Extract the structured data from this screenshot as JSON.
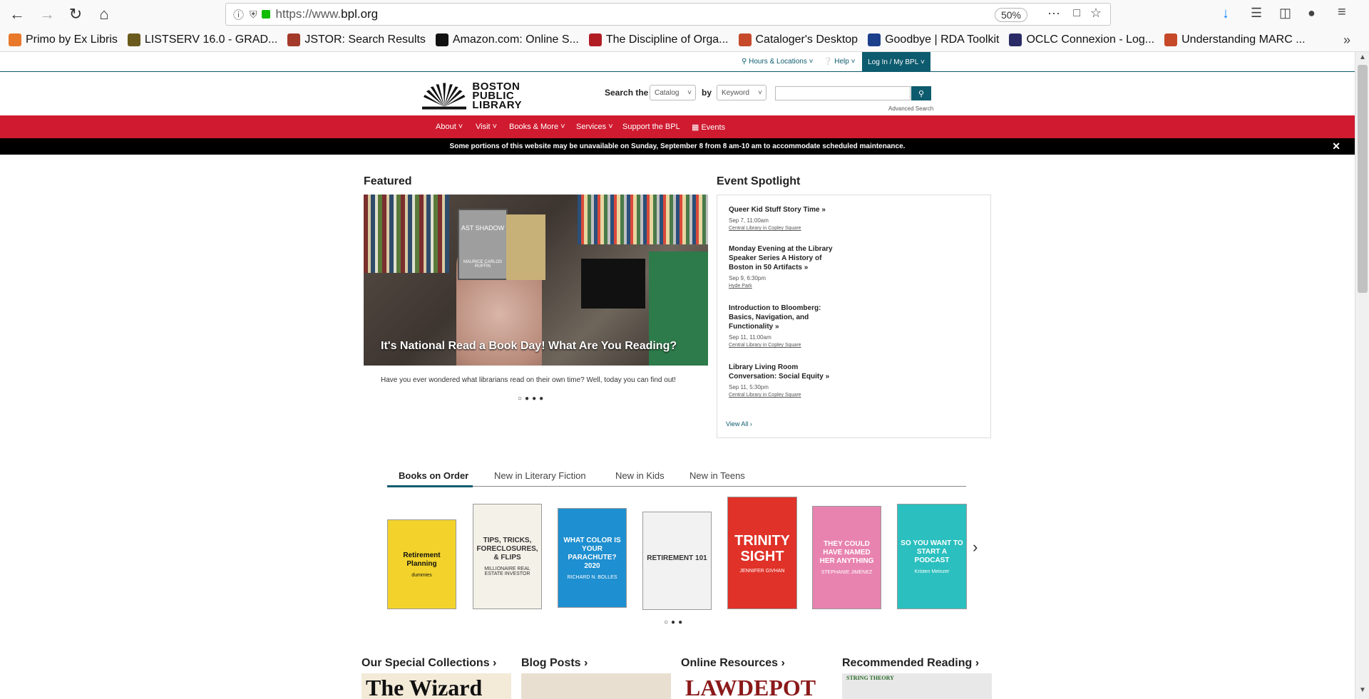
{
  "browser": {
    "url_prefix": "https://www.",
    "url_domain": "bpl.org",
    "zoom": "50%"
  },
  "bookmarks": [
    {
      "label": "Primo by Ex Libris",
      "color": "#e8782a"
    },
    {
      "label": "LISTSERV 16.0 - GRAD...",
      "color": "#6b5a1e"
    },
    {
      "label": "JSTOR: Search Results",
      "color": "#a33a2a"
    },
    {
      "label": "Amazon.com: Online S...",
      "color": "#111111"
    },
    {
      "label": "The Discipline of Orga...",
      "color": "#b01e23"
    },
    {
      "label": "Cataloger's Desktop",
      "color": "#c64a2a"
    },
    {
      "label": "Goodbye | RDA Toolkit",
      "color": "#1b3f8b"
    },
    {
      "label": "OCLC Connexion - Log...",
      "color": "#2a2a66"
    },
    {
      "label": "Understanding MARC ...",
      "color": "#c64a2a"
    }
  ],
  "utility": {
    "hours": "Hours & Locations",
    "help": "Help",
    "login": "Log In / My BPL"
  },
  "logo": {
    "line1": "BOSTON",
    "line2": "PUBLIC",
    "line3": "LIBRARY"
  },
  "search": {
    "label_search_the": "Search the",
    "catalog": "Catalog",
    "label_by": "by",
    "keyword": "Keyword",
    "advanced": "Advanced Search"
  },
  "nav": [
    {
      "label": "About"
    },
    {
      "label": "Visit"
    },
    {
      "label": "Books & More"
    },
    {
      "label": "Services"
    },
    {
      "label": "Support the BPL"
    },
    {
      "label": "Events"
    }
  ],
  "alert": "Some portions of this website may be unavailable on Sunday, September 8 from 8 am-10 am to accommodate scheduled maintenance.",
  "featured": {
    "heading": "Featured",
    "caption": "It's National Read a Book Day! What Are You Reading?",
    "description": "Have you ever wondered what librarians read on their own time? Well, today you can find out!",
    "book_text_1": "AST SHADOW",
    "book_text_2": "MAURICE CARLOS RUFFIN"
  },
  "events": {
    "heading": "Event Spotlight",
    "items": [
      {
        "title": "Queer Kid Stuff Story Time »",
        "date": "Sep 7, 11:00am",
        "location": "Central Library in Copley Square"
      },
      {
        "title": "Monday Evening at the Library Speaker Series A History of Boston in 50 Artifacts »",
        "date": "Sep 9, 6:30pm",
        "location": "Hyde Park"
      },
      {
        "title": "Introduction to Bloomberg: Basics, Navigation, and Functionality »",
        "date": "Sep 11, 11:00am",
        "location": "Central Library in Copley Square"
      },
      {
        "title": "Library Living Room Conversation: Social Equity »",
        "date": "Sep 11, 5:30pm",
        "location": "Central Library in Copley Square"
      }
    ],
    "view_all": "View All ›"
  },
  "tabs": [
    {
      "label": "Books on Order"
    },
    {
      "label": "New in Literary Fiction"
    },
    {
      "label": "New in Kids"
    },
    {
      "label": "New in Teens"
    }
  ],
  "books": [
    {
      "title": "Retirement Planning",
      "sub": "dummies",
      "bg": "#f3d32b"
    },
    {
      "title": "TIPS, TRICKS, FORECLOSURES, & FLIPS",
      "sub": "MILLIONAIRE REAL ESTATE INVESTOR",
      "bg": "#f4f1e8"
    },
    {
      "title": "WHAT COLOR IS YOUR PARACHUTE? 2020",
      "sub": "RICHARD N. BOLLES",
      "bg": "#1e8fd0"
    },
    {
      "title": "RETIREMENT 101",
      "sub": "",
      "bg": "#f2f2f2"
    },
    {
      "title": "TRINITY SIGHT",
      "sub": "JENNIFER GIVHAN",
      "bg": "#e03228"
    },
    {
      "title": "THEY COULD HAVE NAMED HER ANYTHING",
      "sub": "STEPHANIE JIMENEZ",
      "bg": "#e883b0"
    },
    {
      "title": "SO YOU WANT TO START A PODCAST",
      "sub": "Kristen Meinzer",
      "bg": "#2bbfbf"
    }
  ],
  "bottom": [
    {
      "label": "Our Special Collections ›",
      "img_text": "The Wizard"
    },
    {
      "label": "Blog Posts ›",
      "img_text": ""
    },
    {
      "label": "Online Resources ›",
      "img_text": "LAWDEPOT"
    },
    {
      "label": "Recommended Reading ›",
      "img_text": "STRING THEORY"
    }
  ]
}
